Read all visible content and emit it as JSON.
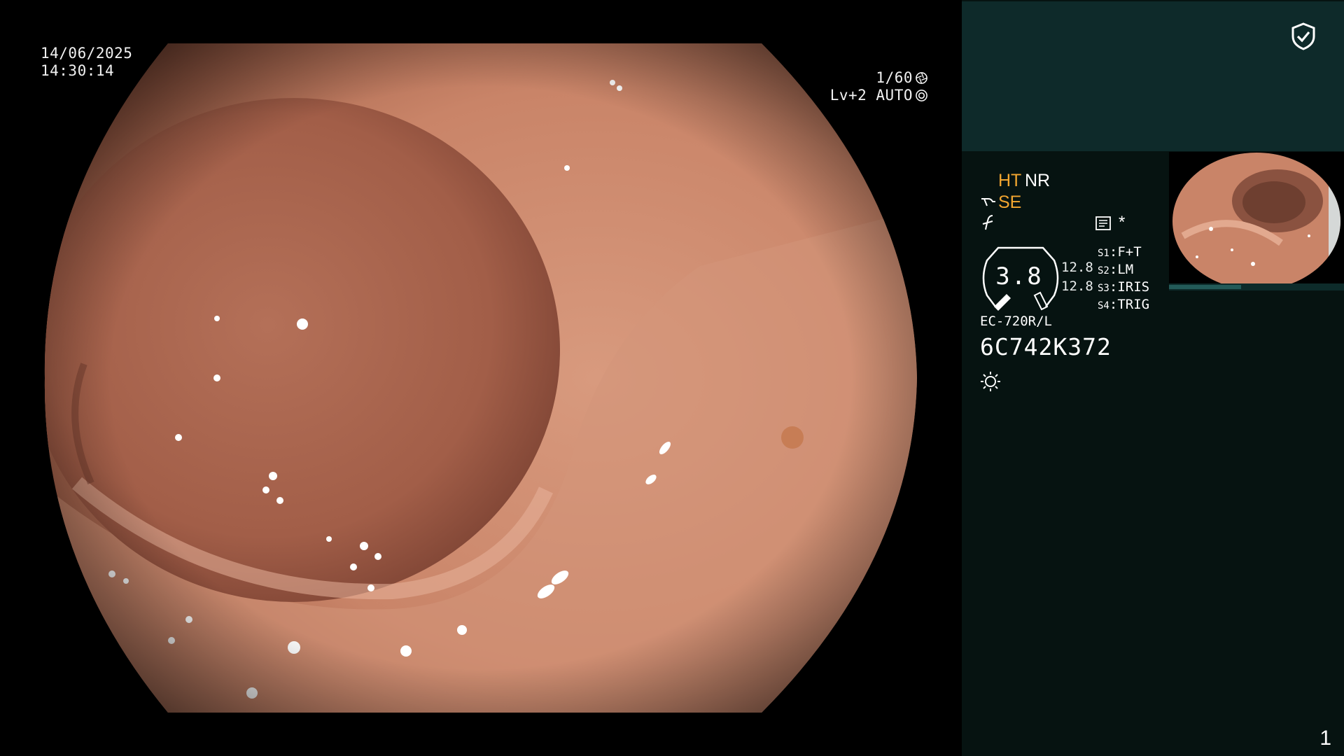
{
  "overlay": {
    "date": "14/06/2025",
    "time": "14:30:14",
    "shutter": "1/60",
    "shutter_icon": "aperture-icon",
    "level": "Lv+2 AUTO",
    "level_icon": "auto-exposure-icon"
  },
  "panel": {
    "status_icon": "shield-check-icon",
    "indicators": {
      "ht": "HT",
      "nr": "NR",
      "se": "SE",
      "asterisk": "*"
    },
    "zoom": {
      "value": "3.8",
      "mag_top": "12.8",
      "mag_bottom": "12.8"
    },
    "switches": [
      {
        "key": "S1",
        "value": "F+T"
      },
      {
        "key": "S2",
        "value": "LM"
      },
      {
        "key": "S3",
        "value": "IRIS"
      },
      {
        "key": "S4",
        "value": "TRIG"
      }
    ],
    "scope_model": "EC-720R/L",
    "scope_serial": "6C742K372",
    "page_number": "1",
    "colors": {
      "accent": "#f2a630",
      "panel_top": "#0e2a2a",
      "panel_bg": "#061311"
    }
  }
}
